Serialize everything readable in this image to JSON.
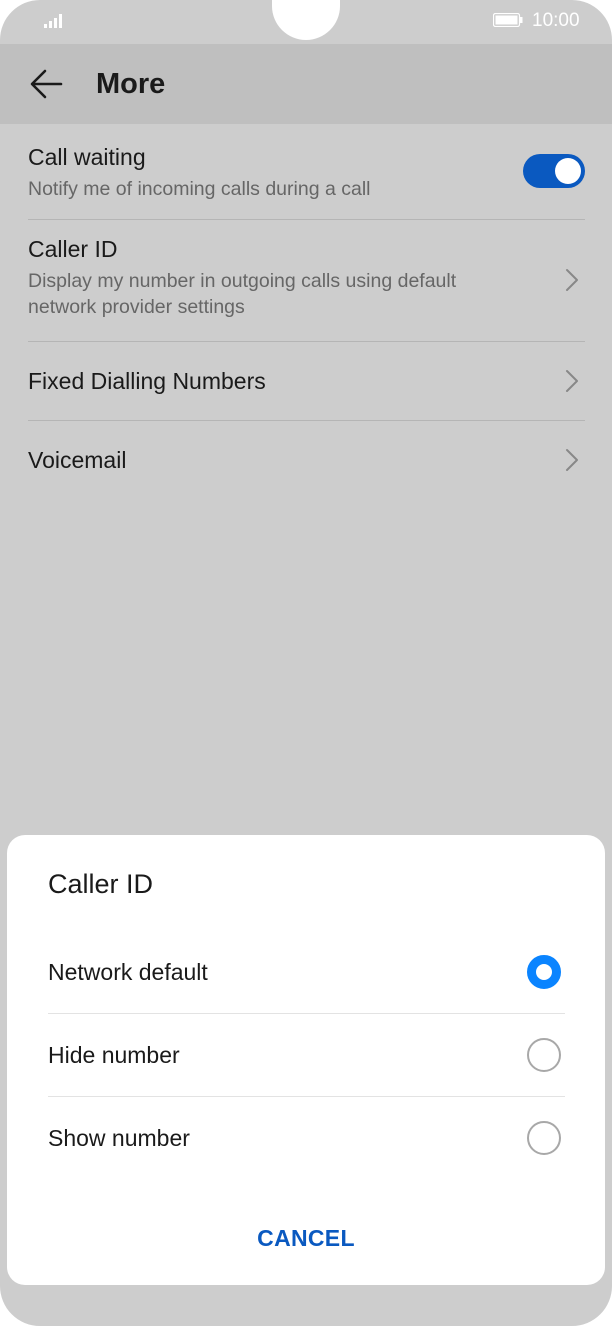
{
  "status_bar": {
    "time": "10:00"
  },
  "header": {
    "title": "More"
  },
  "settings": [
    {
      "title": "Call waiting",
      "subtitle": "Notify me of incoming calls during a call",
      "toggle_on": true
    },
    {
      "title": "Caller ID",
      "subtitle": "Display my number in outgoing calls using default network provider settings"
    },
    {
      "title": "Fixed Dialling Numbers"
    },
    {
      "title": "Voicemail"
    }
  ],
  "dialog": {
    "title": "Caller ID",
    "options": [
      {
        "label": "Network default",
        "selected": true
      },
      {
        "label": "Hide number",
        "selected": false
      },
      {
        "label": "Show number",
        "selected": false
      }
    ],
    "cancel_label": "CANCEL"
  },
  "colors": {
    "accent": "#0a59c0",
    "radio_selected": "#0a84ff",
    "background_dim": "#cdcdcd"
  },
  "icons": [
    "signal-icon",
    "battery-icon",
    "back-arrow-icon",
    "chevron-right-icon"
  ]
}
